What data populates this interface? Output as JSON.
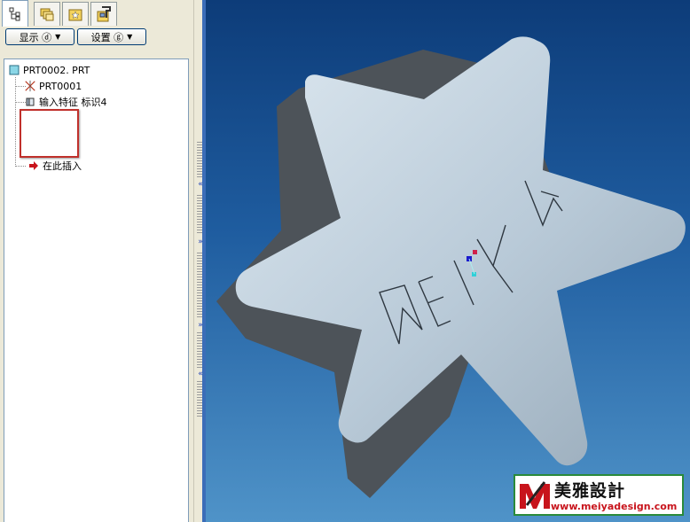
{
  "left_panel": {
    "tabs": [
      {
        "icon": "model-tree-icon"
      },
      {
        "icon": "folder-browser-icon"
      },
      {
        "icon": "favorites-icon"
      },
      {
        "icon": "connections-icon"
      }
    ],
    "display_button": "显示 ⓓ",
    "settings_button": "设置 ⓖ",
    "tree": {
      "root": "PRT0002. PRT",
      "items": [
        {
          "label": "PRT0001",
          "icon": "coordinate-system-icon"
        },
        {
          "label": "输入特征 标识4",
          "icon": "import-feature-icon"
        },
        {
          "label": "在此插入",
          "icon": "insert-here-arrow-icon"
        }
      ]
    }
  },
  "viewport": {
    "model_text": "MEIYA",
    "background_top": "#0d3c79",
    "background_bottom": "#4f93c8",
    "face_color": "#b6c7d5",
    "side_color": "#4d5359"
  },
  "watermark": {
    "title": "美雅設計",
    "url": "www.meiyadesign.com",
    "accent": "#c8141c"
  }
}
